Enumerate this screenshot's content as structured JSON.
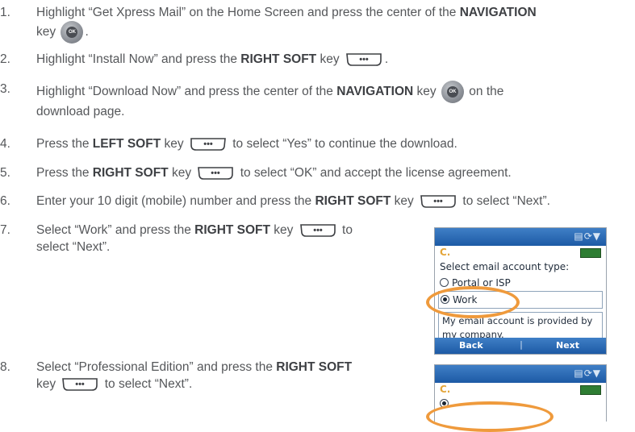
{
  "steps": [
    {
      "number": "1.",
      "line1_pre": "Highlight “Get Xpress Mail” on the Home Screen and press the center of the ",
      "line1_key": "NAVIGATION",
      "line2_pre": "key",
      "line2_post": "."
    },
    {
      "number": "2.",
      "pre": "Highlight “Install Now” and press the ",
      "key": "RIGHT SOFT",
      "key_suffix": " key",
      "post": "."
    },
    {
      "number": "3.",
      "pre": "Highlight “Download Now” and press the center of the ",
      "key": "NAVIGATION",
      "key_suffix": " key",
      "post": " on the",
      "line2": "download page."
    },
    {
      "number": "4.",
      "pre": "Press the ",
      "key": "LEFT SOFT",
      "key_suffix": " key",
      "post": " to select “Yes” to continue the download."
    },
    {
      "number": "5.",
      "pre": "Press the ",
      "key": "RIGHT SOFT",
      "key_suffix": " key",
      "post": " to select “OK” and accept the license agreement."
    },
    {
      "number": "6.",
      "pre": "Enter your 10 digit (mobile) number and press the ",
      "key": "RIGHT SOFT",
      "key_suffix": " key",
      "post": " to select “Next”."
    },
    {
      "number": "7.",
      "pre": "Select “Work” and press the ",
      "key": "RIGHT SOFT",
      "key_suffix": " key",
      "post": " to",
      "line2": "select “Next”."
    },
    {
      "number": "8.",
      "pre": "Select “Professional Edition” and press the ",
      "key": "RIGHT SOFT",
      "line2_pre": "key",
      "line2_post": " to select “Next”."
    }
  ],
  "key_icons": {
    "nav_key_label": "OK",
    "soft_key_glyph": "•••"
  },
  "phone1": {
    "logo": "C.",
    "prompt": "Select email account type:",
    "options": [
      "Portal or ISP",
      "Work"
    ],
    "selected": "Work",
    "description": "My email account is provided by my company.",
    "left_soft": "Back",
    "right_soft": "Next"
  },
  "phone2": {
    "logo": "C."
  },
  "colors": {
    "text": "#55575a",
    "bold_text": "#3e4044",
    "highlight_ring": "#ef9a3c",
    "phone_bar": "#1d5aa5"
  }
}
